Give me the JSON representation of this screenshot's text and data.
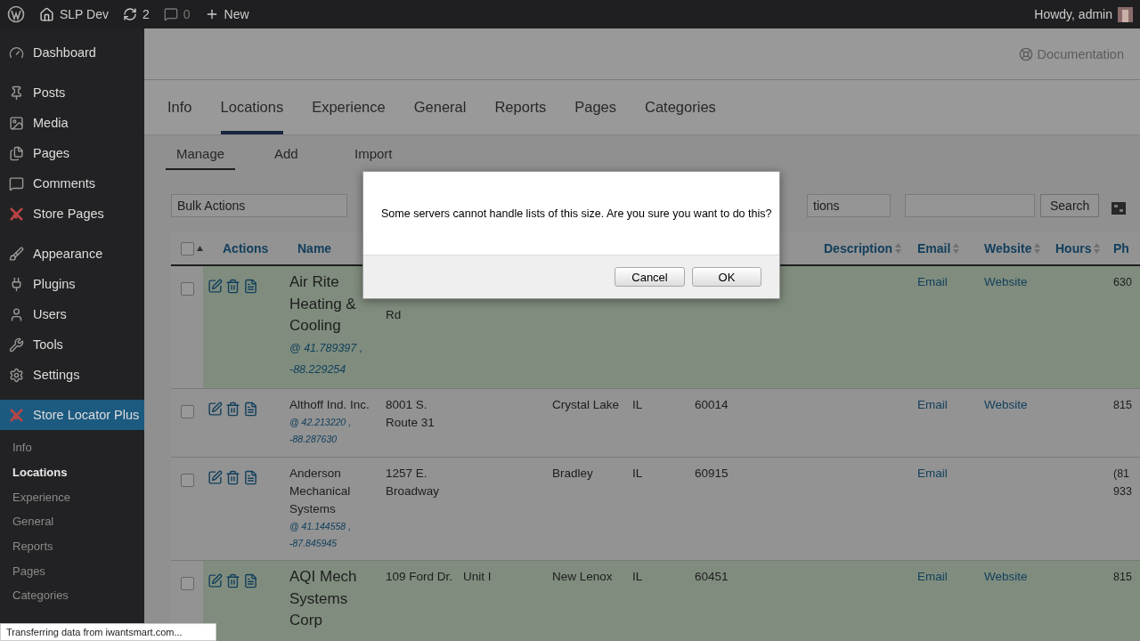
{
  "admin_bar": {
    "site": "SLP Dev",
    "updates": "2",
    "comments": "0",
    "new": "New",
    "greeting": "Howdy, admin"
  },
  "sidebar": {
    "items": [
      {
        "label": "Dashboard",
        "selected": false
      },
      {
        "label": "Posts",
        "selected": false
      },
      {
        "label": "Media",
        "selected": false
      },
      {
        "label": "Pages",
        "selected": false
      },
      {
        "label": "Comments",
        "selected": false
      },
      {
        "label": "Store Pages",
        "selected": false
      },
      {
        "label": "Appearance",
        "selected": false
      },
      {
        "label": "Plugins",
        "selected": false
      },
      {
        "label": "Users",
        "selected": false
      },
      {
        "label": "Tools",
        "selected": false
      },
      {
        "label": "Settings",
        "selected": false
      },
      {
        "label": "Store Locator Plus",
        "selected": true
      }
    ],
    "submenu": [
      {
        "label": "Info",
        "selected": false
      },
      {
        "label": "Locations",
        "selected": true
      },
      {
        "label": "Experience",
        "selected": false
      },
      {
        "label": "General",
        "selected": false
      },
      {
        "label": "Reports",
        "selected": false
      },
      {
        "label": "Pages",
        "selected": false
      },
      {
        "label": "Categories",
        "selected": false
      }
    ]
  },
  "documentation_link": "Documentation",
  "tabs": [
    {
      "label": "Info",
      "selected": false
    },
    {
      "label": "Locations",
      "selected": true
    },
    {
      "label": "Experience",
      "selected": false
    },
    {
      "label": "General",
      "selected": false
    },
    {
      "label": "Reports",
      "selected": false
    },
    {
      "label": "Pages",
      "selected": false
    },
    {
      "label": "Categories",
      "selected": false
    }
  ],
  "subtabs": [
    {
      "label": "Manage",
      "selected": true
    },
    {
      "label": "Add",
      "selected": false
    },
    {
      "label": "Import",
      "selected": false
    }
  ],
  "toolbar": {
    "bulk_actions": "Bulk Actions",
    "filter_value": "tions",
    "search_button": "Search"
  },
  "table": {
    "select_all_checked": false,
    "columns": [
      {
        "label": "Actions",
        "sortable": false
      },
      {
        "label": "Name",
        "sortable": false
      },
      {
        "label": "Description",
        "sortable": true
      },
      {
        "label": "Email",
        "sortable": true
      },
      {
        "label": "Website",
        "sortable": true
      },
      {
        "label": "Hours",
        "sortable": true
      },
      {
        "label": "Ph",
        "sortable": false
      }
    ],
    "rows": [
      {
        "highlighted": true,
        "checked": false,
        "name": "Air Rite Heating & Cooling",
        "coords": "@ 41.789397 , -88.229254",
        "address": "Rd",
        "city": "",
        "state": "",
        "zip": "",
        "email": "Email",
        "website": "Website",
        "phone": "630"
      },
      {
        "highlighted": false,
        "checked": false,
        "name": "Althoff Ind. Inc.",
        "coords": "@ 42.213220 , -88.287630",
        "address": "8001 S. Route 31",
        "address2": "",
        "city": "Crystal Lake",
        "state": "IL",
        "zip": "60014",
        "email": "Email",
        "website": "Website",
        "phone": "815"
      },
      {
        "highlighted": false,
        "checked": false,
        "name": "Anderson Mechanical Systems",
        "coords": "@ 41.144558 , -87.845945",
        "address": "1257 E. Broadway",
        "address2": "",
        "city": "Bradley",
        "state": "IL",
        "zip": "60915",
        "email": "Email",
        "website": "",
        "phone": "(81 933"
      },
      {
        "highlighted": true,
        "checked": false,
        "name": "AQI Mech Systems Corp",
        "coords": "",
        "address": "109 Ford Dr.",
        "address2": "Unit I",
        "city": "New Lenox",
        "state": "IL",
        "zip": "60451",
        "email": "Email",
        "website": "Website",
        "phone": "815"
      }
    ]
  },
  "dialog": {
    "message": "Some servers cannot handle lists of this size. Are you sure you want to do this?",
    "buttons": [
      "Cancel",
      "OK"
    ]
  },
  "status_bar": "Transferring data from iwantsmart.com..."
}
